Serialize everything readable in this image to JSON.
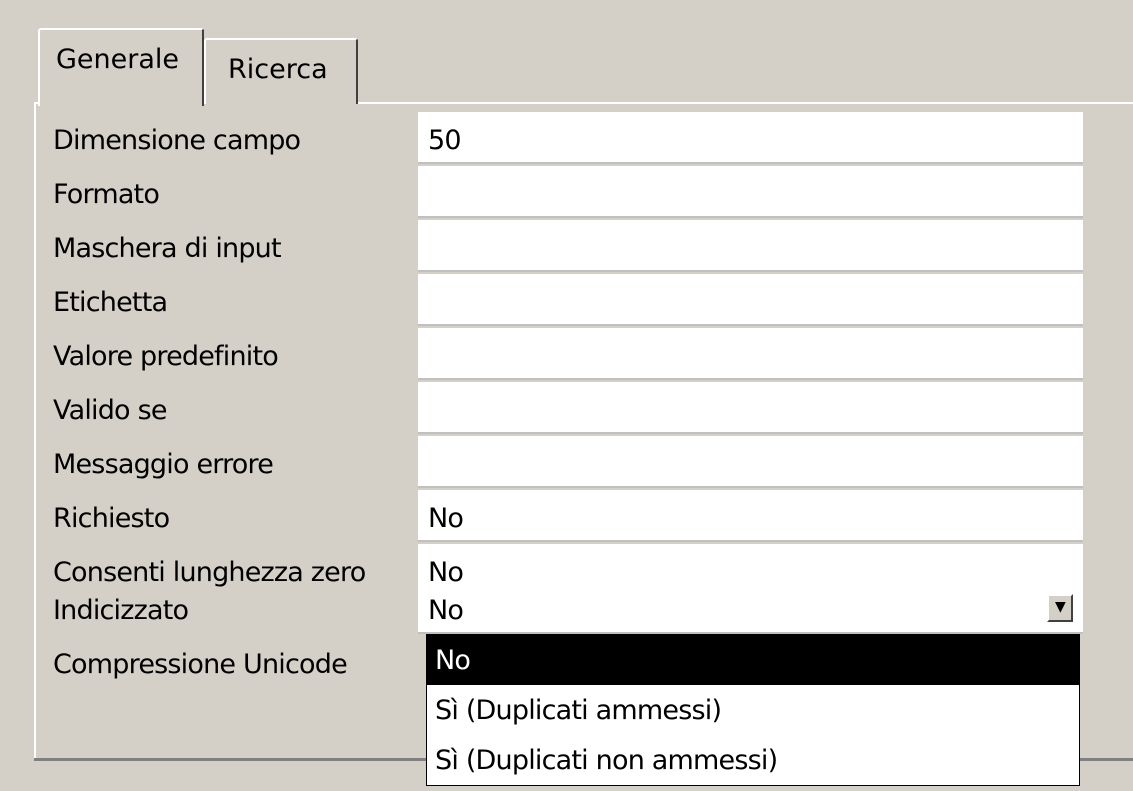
{
  "tabs": [
    {
      "label": "Generale",
      "active": true
    },
    {
      "label": "Ricerca",
      "active": false
    }
  ],
  "properties": [
    {
      "label": "Dimensione campo",
      "value": "50"
    },
    {
      "label": "Formato",
      "value": ""
    },
    {
      "label": "Maschera di input",
      "value": ""
    },
    {
      "label": "Etichetta",
      "value": ""
    },
    {
      "label": "Valore predefinito",
      "value": ""
    },
    {
      "label": "Valido se",
      "value": ""
    },
    {
      "label": "Messaggio errore",
      "value": ""
    },
    {
      "label": "Richiesto",
      "value": "No"
    },
    {
      "label": "Consenti lunghezza zero",
      "value": "No"
    },
    {
      "label": "Indicizzato",
      "value": "No"
    },
    {
      "label": "Compressione Unicode",
      "value": ""
    }
  ],
  "dropdown": {
    "arrow_icon": "chevron-down-icon",
    "options": [
      "No",
      "Sì (Duplicati ammessi)",
      "Sì (Duplicati non ammessi)"
    ],
    "selected": "No"
  },
  "colors": {
    "background": "#d4d0c8",
    "field": "#ffffff",
    "highlight": "#000000"
  }
}
